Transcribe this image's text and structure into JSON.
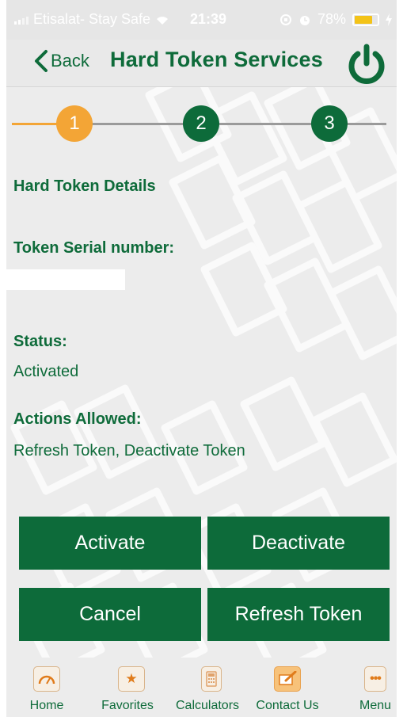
{
  "status_bar": {
    "carrier": "Etisalat- Stay Safe",
    "time": "21:39",
    "battery_percent": "78%",
    "battery_level": 0.78
  },
  "nav": {
    "back_label": "Back",
    "title": "Hard Token Services"
  },
  "stepper": {
    "steps": [
      "1",
      "2",
      "3"
    ],
    "active_step": 1,
    "active_color": "#f3a536",
    "inactive_color": "#0d6b3a"
  },
  "details": {
    "section_title": "Hard Token Details",
    "serial_label": "Token Serial number:",
    "serial_value": "",
    "status_label": "Status:",
    "status_value": "Activated",
    "actions_label": "Actions Allowed:",
    "actions_value": "Refresh Token, Deactivate Token"
  },
  "buttons": {
    "activate": "Activate",
    "deactivate": "Deactivate",
    "cancel": "Cancel",
    "refresh": "Refresh Token"
  },
  "tabbar": {
    "items": [
      {
        "label": "Home",
        "icon": "speedometer-icon"
      },
      {
        "label": "Favorites",
        "icon": "star-icon"
      },
      {
        "label": "Calculators",
        "icon": "calculator-icon"
      },
      {
        "label": "Contact Us",
        "icon": "contact-icon"
      },
      {
        "label": "Menu",
        "icon": "more-icon"
      }
    ]
  },
  "colors": {
    "brand_green": "#0d6b3a",
    "accent_orange": "#f3a536",
    "battery_yellow": "#f3c318"
  }
}
